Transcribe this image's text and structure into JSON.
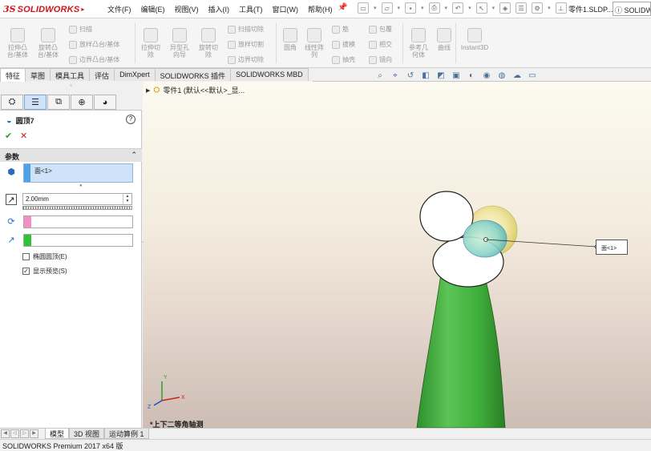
{
  "app": {
    "logo_ds": "3S",
    "logo_text": "SOLIDWORKS",
    "document_title": "零件1.SLDP...",
    "help_search": "SOLIDWO"
  },
  "menu": [
    "文件(F)",
    "编辑(E)",
    "视图(V)",
    "插入(I)",
    "工具(T)",
    "窗口(W)",
    "帮助(H)"
  ],
  "ribbon": {
    "big_buttons": [
      {
        "label": "拉伸凸\n台/基体",
        "icon": "extrude-boss-icon"
      },
      {
        "label": "旋转凸\n台/基体",
        "icon": "revolve-boss-icon"
      },
      {
        "label": "拉伸切\n除",
        "icon": "extrude-cut-icon"
      },
      {
        "label": "异型孔\n向导",
        "icon": "hole-wizard-icon"
      },
      {
        "label": "旋转切\n除",
        "icon": "revolve-cut-icon"
      },
      {
        "label": "圆角",
        "icon": "fillet-icon"
      },
      {
        "label": "线性阵\n列",
        "icon": "linear-pattern-icon"
      },
      {
        "label": "参考几\n何体",
        "icon": "reference-geometry-icon"
      },
      {
        "label": "曲线",
        "icon": "curves-icon"
      },
      {
        "label": "Instant3D",
        "icon": "instant3d-icon"
      }
    ],
    "small_buttons": [
      {
        "label": "扫描",
        "icon": "sweep-icon"
      },
      {
        "label": "放样凸台/基体",
        "icon": "loft-icon"
      },
      {
        "label": "边界凸台/基体",
        "icon": "boundary-boss-icon"
      },
      {
        "label": "扫描切除",
        "icon": "swept-cut-icon"
      },
      {
        "label": "放样切割",
        "icon": "lofted-cut-icon"
      },
      {
        "label": "边界切除",
        "icon": "boundary-cut-icon"
      },
      {
        "label": "筋",
        "icon": "rib-icon"
      },
      {
        "label": "拔模",
        "icon": "draft-icon"
      },
      {
        "label": "抽壳",
        "icon": "shell-icon"
      },
      {
        "label": "包覆",
        "icon": "wrap-icon"
      },
      {
        "label": "相交",
        "icon": "intersect-icon"
      },
      {
        "label": "镜向",
        "icon": "mirror-icon"
      }
    ]
  },
  "tabs": [
    "特征",
    "草图",
    "模具工具",
    "评估",
    "DimXpert",
    "SOLIDWORKS 插件",
    "SOLIDWORKS MBD"
  ],
  "property_manager": {
    "title": "圆顶7",
    "help": "?",
    "ok": "✔",
    "cancel": "✕",
    "section": "参数",
    "section_chevron": "^",
    "face_value": "面<1>",
    "distance_value": "2.00mm",
    "checkbox_elliptical": "椭圆圆顶(E)",
    "checkbox_preview": "显示预览(S)",
    "elliptical_checked": false,
    "preview_checked": true
  },
  "feature_tree": {
    "part_label": "零件1 (默认<<默认>_显..."
  },
  "viewport": {
    "view_label": "*上下二等角轴测",
    "callout_label": "面<1>",
    "triad_x": "X",
    "triad_y": "Y",
    "triad_z": "Z"
  },
  "bottom_tabs": [
    "模型",
    "3D 视图",
    "运动算例 1"
  ],
  "status": "SOLIDWORKS Premium 2017 x64 版",
  "colors": {
    "brand": "#d4131c",
    "cone_green": "#3fae3a",
    "face_selection": "#4fa0e4",
    "dome_preview": "#e9dd6d"
  }
}
